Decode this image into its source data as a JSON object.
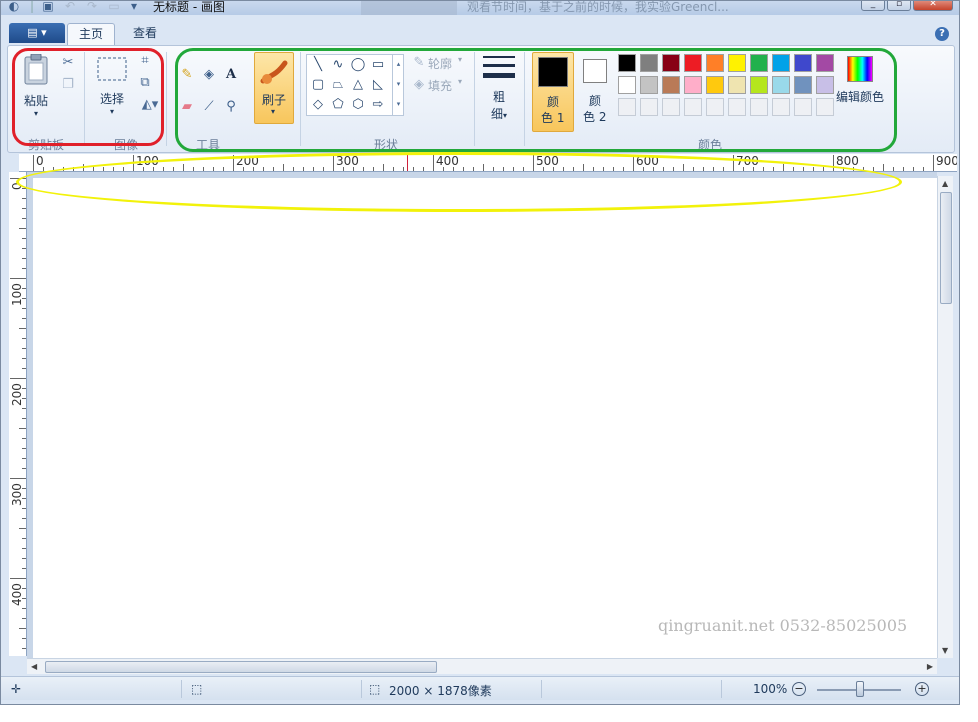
{
  "window": {
    "title": "无标题 - 画图",
    "background_text": "观看节时间，基于之前的时候，我实验Greencl..."
  },
  "tabs": [
    {
      "label": "主页",
      "active": true
    },
    {
      "label": "查看",
      "active": false
    }
  ],
  "file_menu_label": "▤ ▾",
  "ribbon": {
    "clipboard": {
      "label": "剪贴板",
      "paste_label": "粘贴"
    },
    "image": {
      "label": "图像",
      "select_label": "选择"
    },
    "tools": {
      "label": "工具"
    },
    "brush": {
      "label": "刷子"
    },
    "shapes": {
      "label": "形状",
      "outline_label": "轮廓",
      "fill_label": "填充"
    },
    "size": {
      "label_line1": "粗",
      "label_line2": "细"
    },
    "colors": {
      "label": "颜色",
      "color1_line1": "颜",
      "color1_line2": "色 1",
      "color2_line1": "颜",
      "color2_line2": "色 2",
      "edit_label": "编辑颜色",
      "color1_value": "#000000",
      "color2_value": "#ffffff",
      "palette_row1": [
        "#000000",
        "#7f7f7f",
        "#880015",
        "#ed1c24",
        "#ff7f27",
        "#fff200",
        "#22b14c",
        "#00a2e8",
        "#3f48cc",
        "#a349a4"
      ],
      "palette_row2": [
        "#ffffff",
        "#c3c3c3",
        "#b97a57",
        "#ffaec9",
        "#ffc90e",
        "#efe4b0",
        "#b5e61d",
        "#99d9ea",
        "#7092be",
        "#c8bfe7"
      ],
      "palette_row3": [
        "#eef0f4",
        "#eef0f4",
        "#eef0f4",
        "#eef0f4",
        "#eef0f4",
        "#eef0f4",
        "#eef0f4",
        "#eef0f4",
        "#eef0f4",
        "#eef0f4"
      ]
    }
  },
  "ruler": {
    "h_labels": [
      "0",
      "100",
      "200",
      "300",
      "400",
      "500",
      "600",
      "700",
      "800",
      "900"
    ],
    "v_labels": [
      "0",
      "100",
      "200",
      "300",
      "400"
    ]
  },
  "annotations": {
    "red": "#e0202a",
    "green": "#22a83a",
    "yellow": "#f2f20a"
  },
  "statusbar": {
    "size_text": "2000 × 1878像素",
    "zoom_text": "100%",
    "zoom_percent": 100
  },
  "watermark": "qingruanit.net 0532-85025005"
}
